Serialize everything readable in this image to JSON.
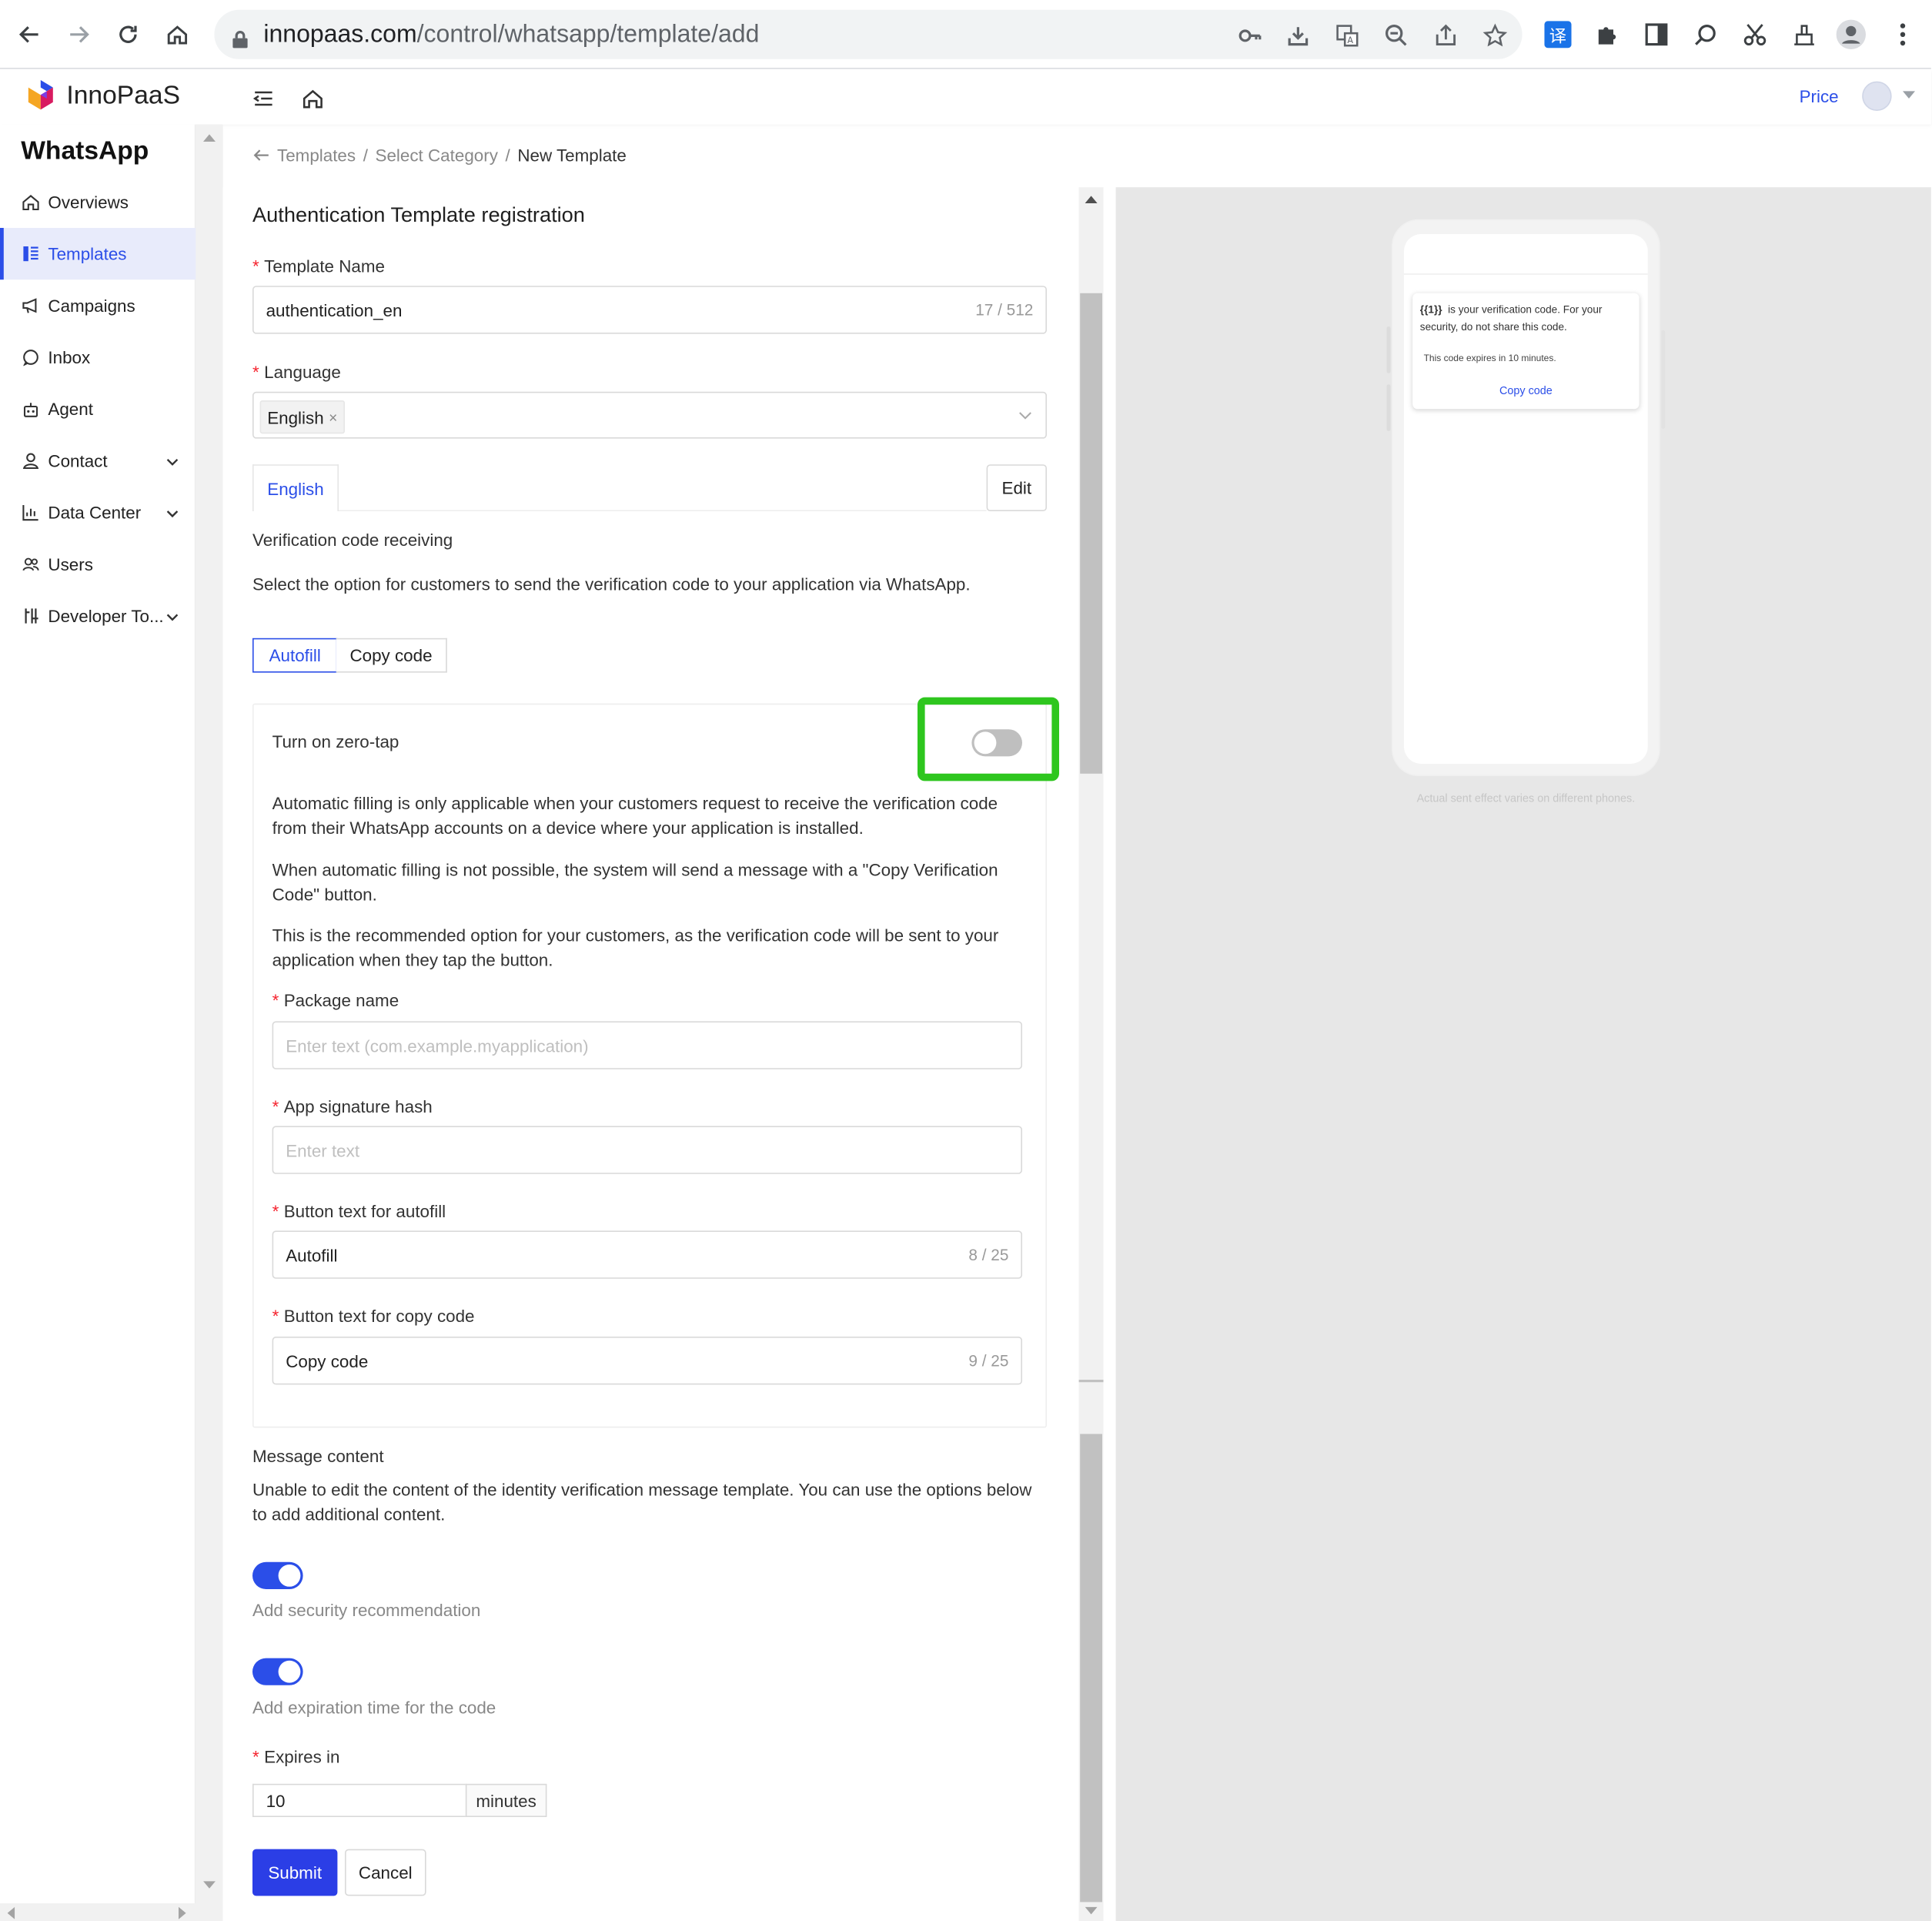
{
  "browser": {
    "url_host": "innopaas.com",
    "url_path": "/control/whatsapp/template/add",
    "icons": [
      "back-icon",
      "forward-icon",
      "reload-icon",
      "home-icon",
      "lock-icon",
      "key-icon",
      "install-icon",
      "translate-icon",
      "zoom-out-icon",
      "share-icon",
      "star-icon",
      "extension-translate-icon",
      "puzzle-icon",
      "side-panel-icon",
      "search-lens-icon",
      "scissors-icon",
      "cleaner-icon",
      "profile-icon",
      "menu-dots-icon"
    ]
  },
  "header": {
    "brand": "InnoPaaS",
    "price_link": "Price"
  },
  "sidebar": {
    "title": "WhatsApp",
    "items": [
      {
        "label": "Overviews",
        "icon": "home-icon"
      },
      {
        "label": "Templates",
        "icon": "templates-icon",
        "active": true
      },
      {
        "label": "Campaigns",
        "icon": "megaphone-icon"
      },
      {
        "label": "Inbox",
        "icon": "chat-icon"
      },
      {
        "label": "Agent",
        "icon": "robot-icon"
      },
      {
        "label": "Contact",
        "icon": "user-icon",
        "expandable": true
      },
      {
        "label": "Data Center",
        "icon": "chart-icon",
        "expandable": true
      },
      {
        "label": "Users",
        "icon": "users-icon"
      },
      {
        "label": "Developer To...",
        "icon": "tools-icon",
        "expandable": true
      }
    ]
  },
  "breadcrumb": {
    "items": [
      "Templates",
      "Select Category",
      "New Template"
    ]
  },
  "form": {
    "title": "Authentication Template registration",
    "template_name": {
      "label": "Template Name",
      "value": "authentication_en",
      "count": "17 / 512"
    },
    "language": {
      "label": "Language",
      "selected": "English",
      "remove": "×"
    },
    "tab_label": "English",
    "edit_label": "Edit",
    "verification_heading": "Verification code receiving",
    "verification_desc": "Select the option for customers to send the verification code to your application via WhatsApp.",
    "mode_options": [
      "Autofill",
      "Copy code"
    ],
    "mode_selected": "Autofill",
    "zero_tap": {
      "label": "Turn on zero-tap",
      "enabled": false,
      "para1": "Automatic filling is only applicable when your customers request to receive the verification code from their WhatsApp accounts on a device where your application is installed.",
      "para2": "When automatic filling is not possible, the system will send a message with a \"Copy Verification Code\" button.",
      "para3": "This is the recommended option for your customers, as the verification code will be sent to your application when they tap the button."
    },
    "package_name": {
      "label": "Package name",
      "placeholder": "Enter text (com.example.myapplication)"
    },
    "app_signature": {
      "label": "App signature hash",
      "placeholder": "Enter text"
    },
    "autofill_button": {
      "label": "Button text for autofill",
      "value": "Autofill",
      "count": "8 / 25"
    },
    "copy_button": {
      "label": "Button text for copy code",
      "value": "Copy code",
      "count": "9 / 25"
    },
    "message_content": {
      "heading": "Message content",
      "desc": "Unable to edit the content of the identity verification message template. You can use the options below to add additional content."
    },
    "security_toggle": {
      "label": "Add security recommendation",
      "enabled": true
    },
    "expiration_toggle": {
      "label": "Add expiration time for the code",
      "enabled": true
    },
    "expires": {
      "label": "Expires in",
      "value": "10",
      "unit": "minutes"
    },
    "submit_label": "Submit",
    "cancel_label": "Cancel"
  },
  "preview": {
    "placeholder": "{{1}}",
    "message": "is your verification code. For your security, do not share this code.",
    "expiry_note": "This code expires in 10 minutes.",
    "button": "Copy code",
    "note": "Actual sent effect varies on different phones."
  },
  "colors": {
    "accent": "#2b4ee8",
    "highlight": "#2ec61e",
    "required": "#f5222d"
  }
}
